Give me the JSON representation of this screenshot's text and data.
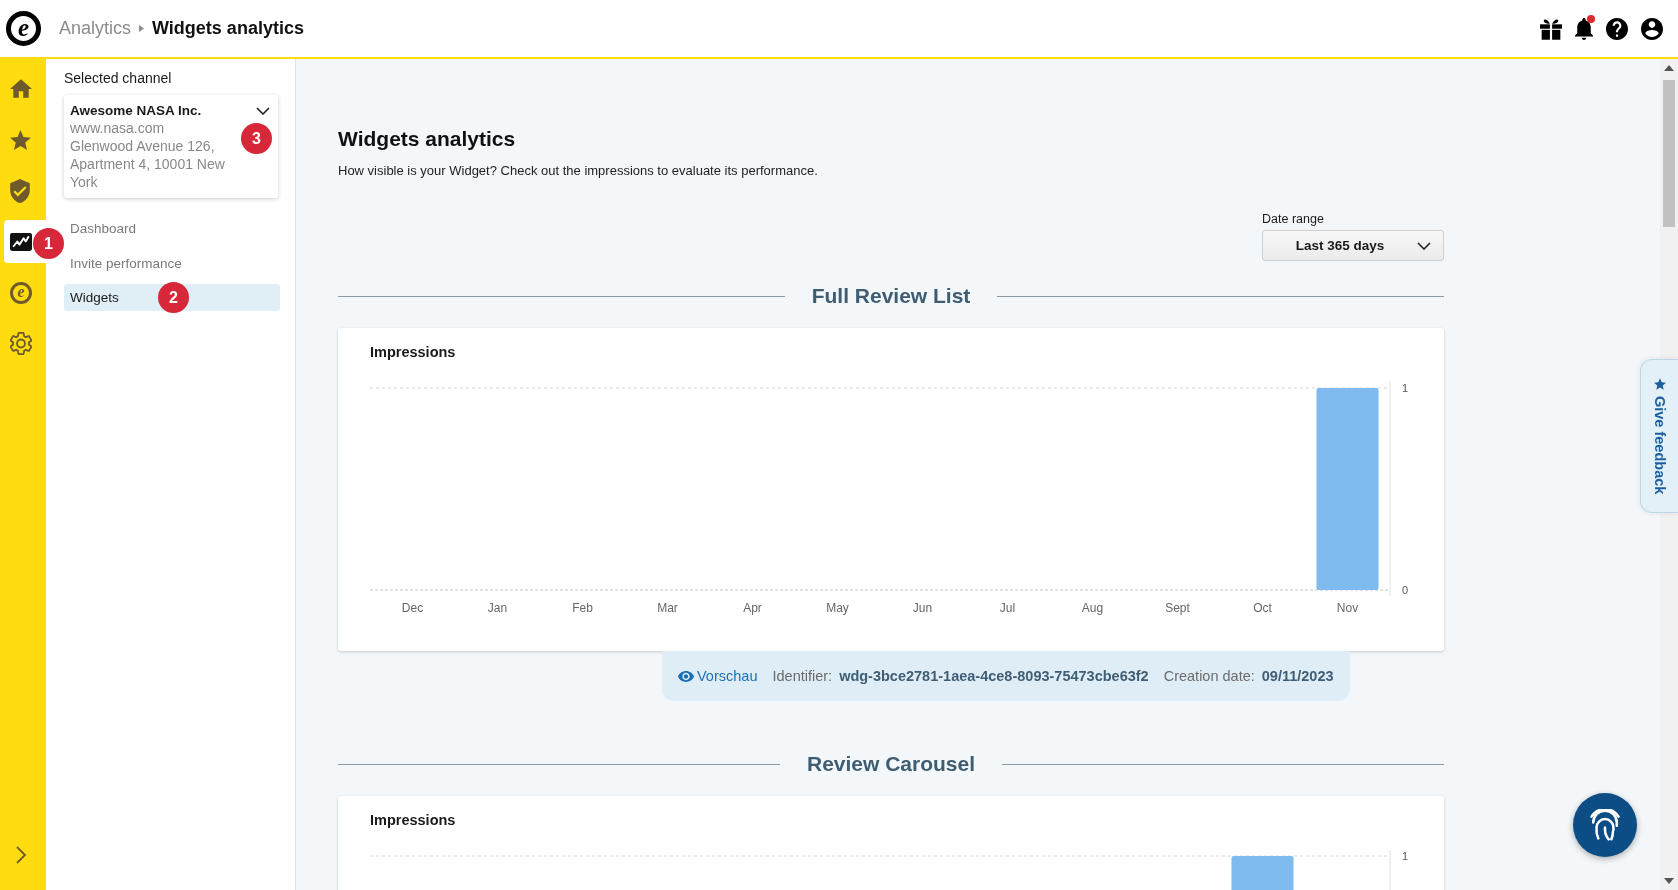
{
  "header": {
    "logo": {
      "glyph": "e"
    },
    "breadcrumb": [
      {
        "label": "Analytics",
        "current": false
      },
      {
        "label": "Widgets analytics",
        "current": true
      }
    ],
    "notifications_unread": true
  },
  "rail": {
    "items": [
      {
        "kind": "home",
        "selected": false
      },
      {
        "kind": "star",
        "selected": false
      },
      {
        "kind": "shield",
        "selected": false
      },
      {
        "kind": "analytics",
        "selected": true,
        "marker": "1"
      },
      {
        "kind": "glyph",
        "glyph": "e",
        "selected": false
      },
      {
        "kind": "gear",
        "selected": false
      }
    ]
  },
  "sidebar": {
    "channel_label": "Selected channel",
    "channel": {
      "name": "Awesome NASA Inc.",
      "url": "www.nasa.com",
      "address": "Glenwood Avenue 126, Apartment 4, 10001 New York",
      "marker": "3"
    },
    "items": [
      {
        "label": "Dashboard",
        "selected": false
      },
      {
        "label": "Invite performance",
        "selected": false
      },
      {
        "label": "Widgets",
        "selected": true,
        "marker": "2"
      }
    ]
  },
  "main": {
    "title": "Widgets analytics",
    "subtitle": "How visible is your Widget? Check out the impressions to evaluate its performance.",
    "date_range": {
      "label": "Date range",
      "value": "Last 365 days"
    },
    "sections": [
      {
        "title": "Full Review List",
        "card_title": "Impressions",
        "chart_data": {
          "type": "bar",
          "categories": [
            "Dec",
            "Jan",
            "Feb",
            "Mar",
            "Apr",
            "May",
            "Jun",
            "Jul",
            "Aug",
            "Sept",
            "Oct",
            "Nov"
          ],
          "values": [
            0,
            0,
            0,
            0,
            0,
            0,
            0,
            0,
            0,
            0,
            0,
            1
          ],
          "ylim": [
            0,
            1
          ],
          "yticks": [
            0,
            1
          ]
        },
        "details": {
          "preview": "Vorschau",
          "identifier_label": "Identifier:",
          "identifier": "wdg-3bce2781-1aea-4ce8-8093-75473cbe63f2",
          "date_label": "Creation date:",
          "date": "09/11/2023"
        }
      },
      {
        "title": "Review Carousel",
        "card_title": "Impressions",
        "axis_label": "1"
      }
    ]
  },
  "feedback": {
    "label": "Give feedback"
  }
}
